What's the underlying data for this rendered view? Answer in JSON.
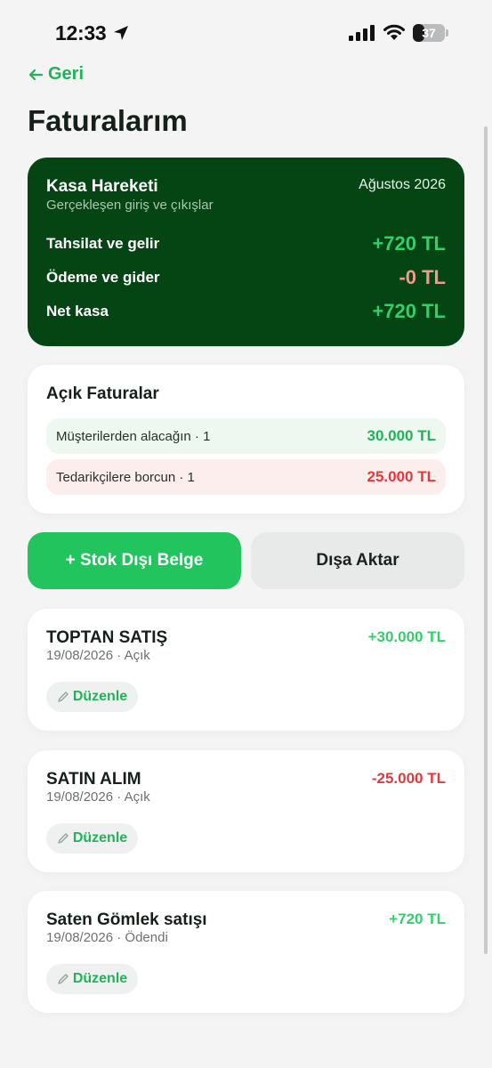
{
  "status_bar": {
    "time": "12:33",
    "battery_level": 37,
    "battery_text": "37"
  },
  "nav": {
    "back_label": "Geri"
  },
  "page": {
    "title": "Faturalarım"
  },
  "cash_summary": {
    "title": "Kasa Hareketi",
    "subtitle": "Gerçekleşen giriş ve çıkışlar",
    "period": "Ağustos 2026",
    "rows": [
      {
        "label": "Tahsilat ve gelir",
        "value": "+720 TL"
      },
      {
        "label": "Ödeme ve gider",
        "value": "-0 TL"
      },
      {
        "label": "Net kasa",
        "value": "+720 TL"
      }
    ]
  },
  "open_invoices": {
    "title": "Açık Faturalar",
    "receivable": {
      "label": "Müşterilerden alacağın · 1",
      "value": "30.000 TL"
    },
    "payable": {
      "label": "Tedarikçilere borcun · 1",
      "value": "25.000 TL"
    }
  },
  "actions": {
    "primary_label": "+ Stok Dışı Belge",
    "secondary_label": "Dışa Aktar"
  },
  "invoices": [
    {
      "title": "TOPTAN SATIŞ",
      "meta": "19/08/2026 · Açık",
      "amount": "+30.000 TL",
      "edit_label": "Düzenle"
    },
    {
      "title": "SATIN ALIM",
      "meta": "19/08/2026 · Açık",
      "amount": "-25.000 TL",
      "edit_label": "Düzenle"
    },
    {
      "title": "Saten Gömlek satışı",
      "meta": "19/08/2026 · Ödendi",
      "amount": "+720 TL",
      "edit_label": "Düzenle"
    }
  ],
  "colors": {
    "accent_green": "#22c45e",
    "dark_green": "#054513",
    "negative_red": "#e0393e"
  },
  "icons": [
    "location-arrow-icon",
    "signal-icon",
    "wifi-icon",
    "battery-icon",
    "arrow-left-icon",
    "pencil-icon"
  ]
}
